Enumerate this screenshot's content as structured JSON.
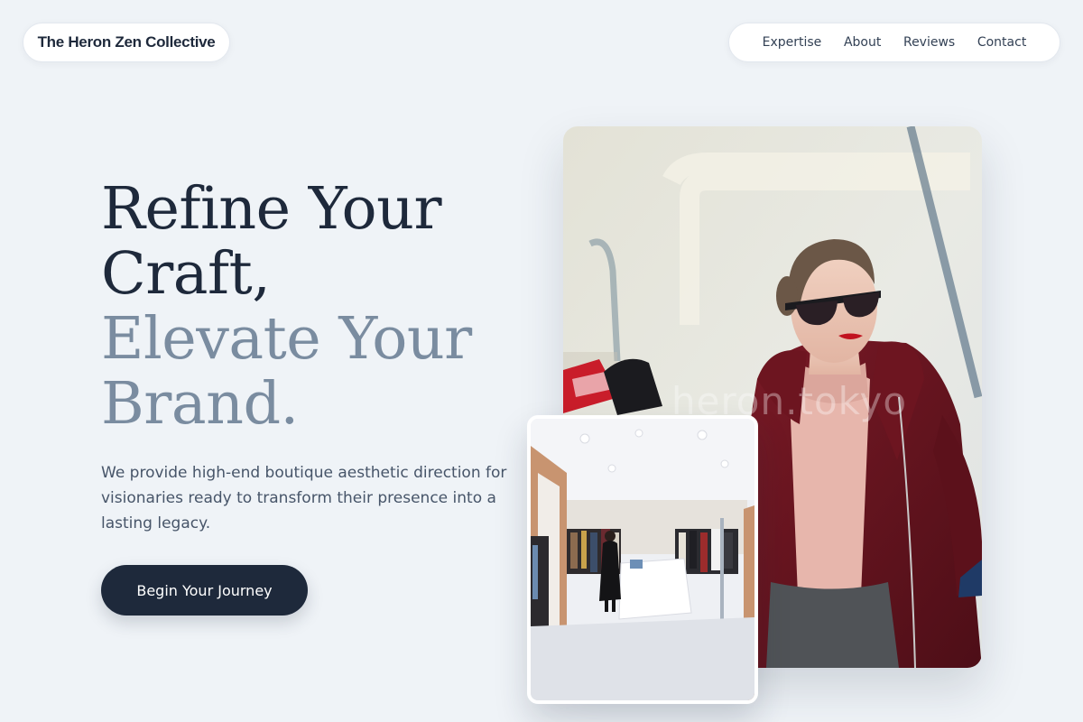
{
  "header": {
    "brand": "The Heron Zen Collective",
    "nav": [
      "Expertise",
      "About",
      "Reviews",
      "Contact"
    ]
  },
  "hero": {
    "heading_line1": "Refine Your",
    "heading_line2": "Craft,",
    "heading_line3": "Elevate Your",
    "heading_line4": "Brand.",
    "subtitle": "We provide high-end boutique aesthetic direction for visionaries ready to transform their presence into a lasting legacy.",
    "cta_label": "Begin Your Journey"
  },
  "images": {
    "main_watermark": "heron.tokyo",
    "main_subject": "woman-in-burgundy-coat-with-sunglasses",
    "store_subject": "boutique-store-interior"
  },
  "colors": {
    "background": "#eff3f7",
    "primary": "#1e293b",
    "muted_heading": "#7a8ca0",
    "body_text": "#475569"
  }
}
